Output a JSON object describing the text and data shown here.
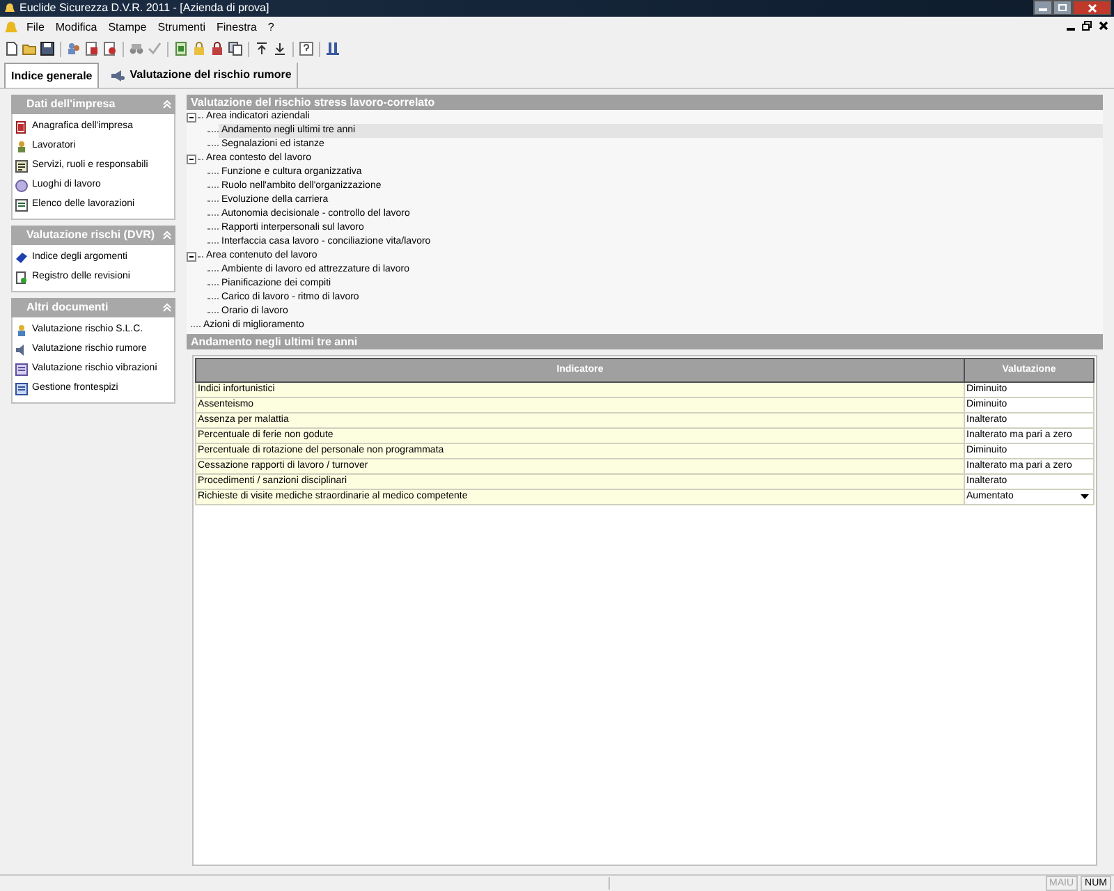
{
  "window": {
    "title": "Euclide Sicurezza D.V.R. 2011 - [Azienda di prova]"
  },
  "menu": [
    "File",
    "Modifica",
    "Stampe",
    "Strumenti",
    "Finestra",
    "?"
  ],
  "tabs": [
    {
      "label": "Indice generale",
      "selected": true,
      "icon": false
    },
    {
      "label": "Valutazione del rischio rumore",
      "selected": false,
      "icon": true
    }
  ],
  "sidebar": [
    {
      "title": "Dati dell'impresa",
      "expanded": true,
      "items": [
        "Anagrafica dell'impresa",
        "Lavoratori",
        "Servizi, ruoli e responsabili",
        "Luoghi di lavoro",
        "Elenco delle lavorazioni"
      ]
    },
    {
      "title": "Valutazione rischi (DVR)",
      "expanded": true,
      "items": [
        "Indice degli argomenti",
        "Registro delle revisioni"
      ]
    },
    {
      "title": "Altri documenti",
      "expanded": true,
      "items": [
        "Valutazione rischio S.L.C.",
        "Valutazione rischio rumore",
        "Valutazione rischio vibrazioni",
        "Gestione frontespizi"
      ]
    }
  ],
  "tree": {
    "title": "Valutazione del rischio stress lavoro-correlato",
    "items": [
      {
        "label": "Area indicatori aziendali",
        "expanded": true,
        "selected": false,
        "children": [
          {
            "label": "Andamento negli ultimi tre anni",
            "selected": true
          },
          {
            "label": "Segnalazioni ed istanze",
            "selected": false
          }
        ]
      },
      {
        "label": "Area contesto del lavoro",
        "expanded": true,
        "selected": false,
        "children": [
          {
            "label": "Funzione e cultura organizzativa",
            "selected": false
          },
          {
            "label": "Ruolo nell'ambito dell'organizzazione",
            "selected": false
          },
          {
            "label": "Evoluzione della carriera",
            "selected": false
          },
          {
            "label": "Autonomia decisionale - controllo del lavoro",
            "selected": false
          },
          {
            "label": "Rapporti interpersonali sul lavoro",
            "selected": false
          },
          {
            "label": "Interfaccia casa lavoro - conciliazione vita/lavoro",
            "selected": false
          }
        ]
      },
      {
        "label": "Area contenuto del lavoro",
        "expanded": true,
        "selected": false,
        "children": [
          {
            "label": "Ambiente di lavoro ed attrezzature di lavoro",
            "selected": false
          },
          {
            "label": "Pianificazione dei compiti",
            "selected": false
          },
          {
            "label": "Carico di lavoro - ritmo di lavoro",
            "selected": false
          },
          {
            "label": "Orario di lavoro",
            "selected": false
          }
        ]
      },
      {
        "label": "Azioni di miglioramento",
        "selected": false
      }
    ]
  },
  "detail": {
    "title": "Andamento negli ultimi tre anni",
    "table": {
      "columns": [
        "Indicatore",
        "Valutazione"
      ],
      "rows": [
        {
          "indicatore": "Indici infortunistici",
          "valutazione": "Diminuito",
          "kind": "text"
        },
        {
          "indicatore": "Assenteismo",
          "valutazione": "Diminuito",
          "kind": "text"
        },
        {
          "indicatore": "Assenza per malattia",
          "valutazione": "Inalterato",
          "kind": "text"
        },
        {
          "indicatore": "Percentuale di ferie non godute",
          "valutazione": "Inalterato ma pari a zero",
          "kind": "text"
        },
        {
          "indicatore": "Percentuale di rotazione del personale non programmata",
          "valutazione": "Diminuito",
          "kind": "text"
        },
        {
          "indicatore": "Cessazione rapporti di lavoro / turnover",
          "valutazione": "Inalterato ma pari a zero",
          "kind": "text"
        },
        {
          "indicatore": "Procedimenti / sanzioni disciplinari",
          "valutazione": "Inalterato",
          "kind": "text"
        },
        {
          "indicatore": "Richieste di visite mediche straordinarie al medico competente",
          "valutazione": "Aumentato",
          "kind": "dropdown"
        }
      ]
    }
  },
  "status_bar": {
    "indicators": [
      {
        "label": "MAIU",
        "disabled": true
      },
      {
        "label": "NUM",
        "disabled": false
      }
    ]
  }
}
